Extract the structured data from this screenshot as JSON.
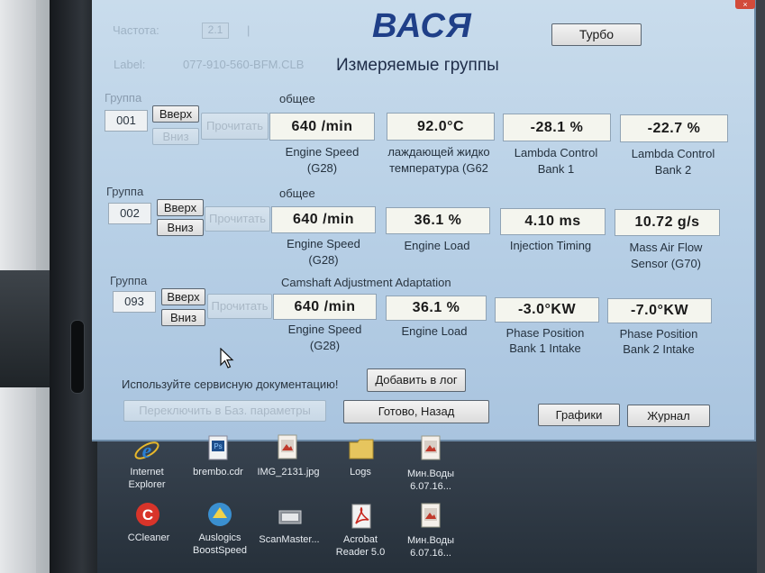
{
  "window": {
    "title": "ВАСЯ",
    "subtitle": "Измеряемые группы",
    "frequency_label": "Частота:",
    "frequency_value": "2.1",
    "frequency_sep": "|",
    "label_caption": "Label:",
    "label_value": "077-910-560-BFM.CLB",
    "turbo_button": "Турбо"
  },
  "groups": [
    {
      "group_label": "Группа",
      "number": "001",
      "up_button": "Вверх",
      "down_button": "Вниз",
      "read_button": "Прочитать",
      "heading": "общее",
      "fields": [
        {
          "value": "640 /min",
          "caption1": "Engine Speed",
          "caption2": "(G28)"
        },
        {
          "value": "92.0°C",
          "caption1": "лаждающей жидко",
          "caption2": "температура (G62"
        },
        {
          "value": "-28.1 %",
          "caption1": "Lambda Control",
          "caption2": "Bank 1"
        },
        {
          "value": "-22.7 %",
          "caption1": "Lambda Control",
          "caption2": "Bank 2"
        }
      ]
    },
    {
      "group_label": "Группа",
      "number": "002",
      "up_button": "Вверх",
      "down_button": "Вниз",
      "read_button": "Прочитать",
      "heading": "общее",
      "fields": [
        {
          "value": "640 /min",
          "caption1": "Engine Speed",
          "caption2": "(G28)"
        },
        {
          "value": "36.1 %",
          "caption1": "Engine Load",
          "caption2": ""
        },
        {
          "value": "4.10 ms",
          "caption1": "Injection Timing",
          "caption2": ""
        },
        {
          "value": "10.72 g/s",
          "caption1": "Mass Air Flow",
          "caption2": "Sensor (G70)"
        }
      ]
    },
    {
      "group_label": "Группа",
      "number": "093",
      "up_button": "Вверх",
      "down_button": "Вниз",
      "read_button": "Прочитать",
      "heading": "Camshaft Adjustment Adaptation",
      "fields": [
        {
          "value": "640 /min",
          "caption1": "Engine Speed",
          "caption2": "(G28)"
        },
        {
          "value": "36.1 %",
          "caption1": "Engine Load",
          "caption2": ""
        },
        {
          "value": "-3.0°KW",
          "caption1": "Phase Position",
          "caption2": "Bank 1 Intake"
        },
        {
          "value": "-7.0°KW",
          "caption1": "Phase Position",
          "caption2": "Bank 2 Intake"
        }
      ]
    }
  ],
  "footer": {
    "notice": "Используйте сервисную документацию!",
    "add_log_button": "Добавить в лог",
    "switch_basic_button": "Переключить в Баз. параметры",
    "done_back_button": "Готово, Назад",
    "graphs_button": "Графики",
    "journal_button": "Журнал"
  },
  "desktop_icons": [
    {
      "label1": "Internet",
      "label2": "Explorer",
      "icon": "ie-icon"
    },
    {
      "label1": "brembo.cdr",
      "label2": "",
      "icon": "ps-file-icon"
    },
    {
      "label1": "IMG_2131.jpg",
      "label2": "",
      "icon": "image-file-icon"
    },
    {
      "label1": "Logs",
      "label2": "",
      "icon": "folder-icon"
    },
    {
      "label1": "Мин.Воды",
      "label2": "6.07.16...",
      "icon": "image-file-icon"
    },
    {
      "label1": "CCleaner",
      "label2": "",
      "icon": "ccleaner-icon"
    },
    {
      "label1": "Auslogics",
      "label2": "BoostSpeed",
      "icon": "auslogics-icon"
    },
    {
      "label1": "ScanMaster...",
      "label2": "",
      "icon": "scanmaster-icon"
    },
    {
      "label1": "Acrobat",
      "label2": "Reader 5.0",
      "icon": "acrobat-icon"
    },
    {
      "label1": "Мин.Воды",
      "label2": "6.07.16...",
      "icon": "image-file-icon"
    }
  ],
  "colors": {
    "window_bg": "#b8d0e6",
    "title_blue": "#1f3f88",
    "field_bg": "#f4f5ee"
  }
}
